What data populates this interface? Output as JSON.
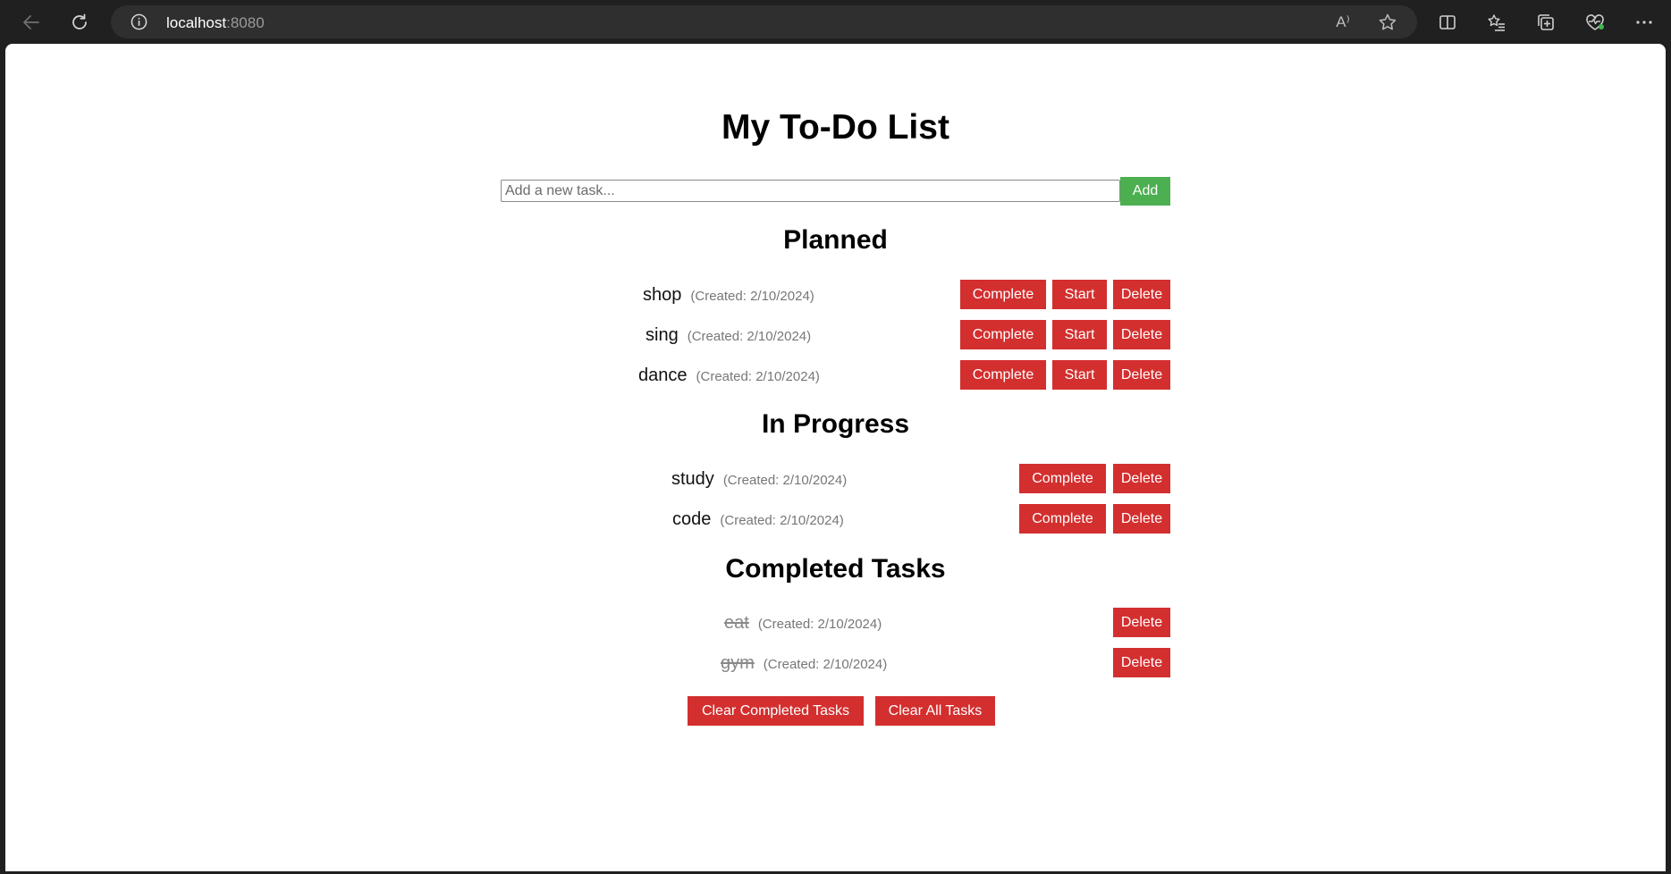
{
  "browser": {
    "url_host": "localhost",
    "url_port": ":8080",
    "read_aloud_label": "A⁾",
    "icons": [
      "back-icon",
      "refresh-icon",
      "info-icon",
      "read-aloud-icon",
      "favorite-star-icon",
      "split-screen-icon",
      "favorites-icon",
      "collections-icon",
      "browser-essentials-icon",
      "more-icon"
    ]
  },
  "app": {
    "title": "My To-Do List",
    "input_placeholder": "Add a new task...",
    "add_label": "Add"
  },
  "planned": {
    "heading": "Planned",
    "tasks": [
      {
        "name": "shop",
        "created": "(Created: 2/10/2024)"
      },
      {
        "name": "sing",
        "created": "(Created: 2/10/2024)"
      },
      {
        "name": "dance",
        "created": "(Created: 2/10/2024)"
      }
    ],
    "complete_label": "Complete",
    "start_label": "Start",
    "delete_label": "Delete"
  },
  "in_progress": {
    "heading": "In Progress",
    "tasks": [
      {
        "name": "study",
        "created": "(Created: 2/10/2024)"
      },
      {
        "name": "code",
        "created": "(Created: 2/10/2024)"
      }
    ],
    "complete_label": "Complete",
    "delete_label": "Delete"
  },
  "completed": {
    "heading": "Completed Tasks",
    "tasks": [
      {
        "name": "eat",
        "created": "(Created: 2/10/2024)"
      },
      {
        "name": "gym",
        "created": "(Created: 2/10/2024)"
      }
    ],
    "delete_label": "Delete"
  },
  "footer": {
    "clear_completed_label": "Clear Completed Tasks",
    "clear_all_label": "Clear All Tasks"
  },
  "colors": {
    "add_button": "#4caf50",
    "action_button": "#d32f2f",
    "browser_chrome": "#202020"
  }
}
